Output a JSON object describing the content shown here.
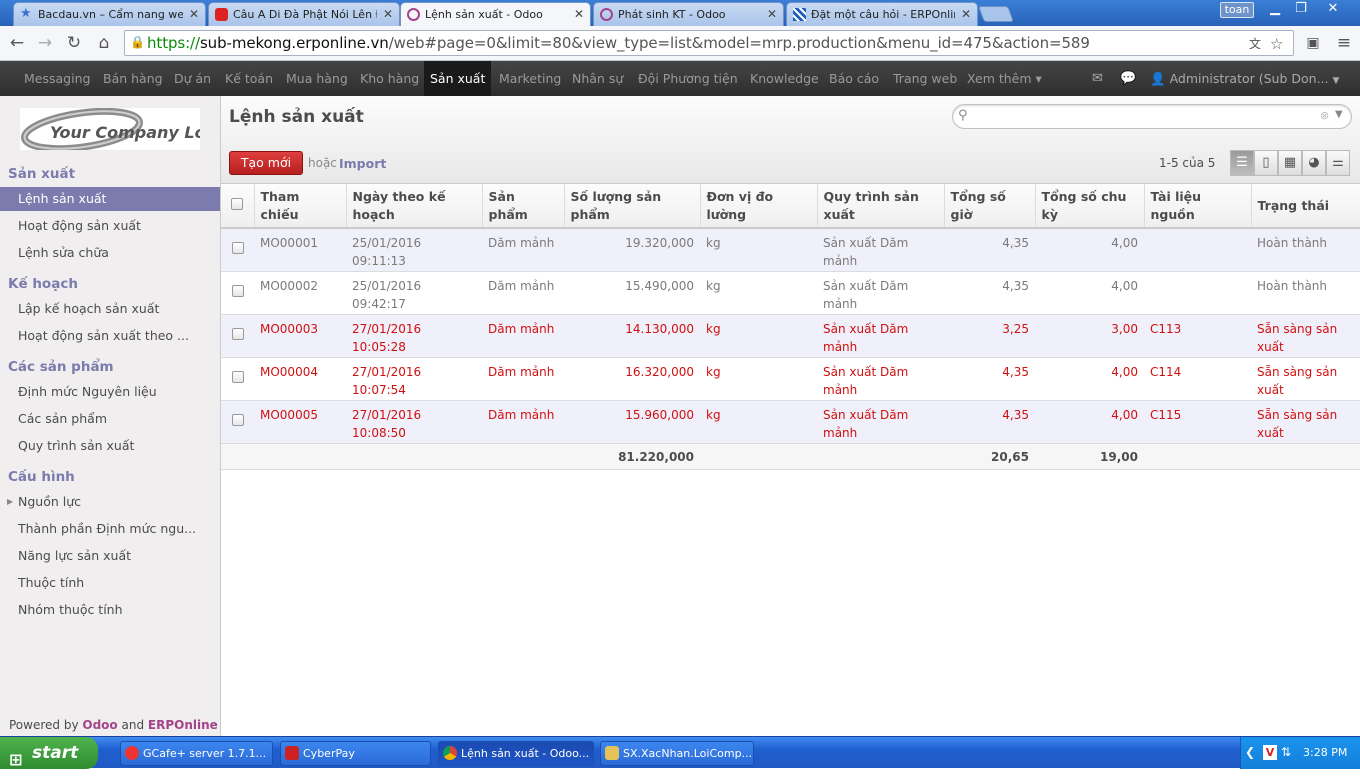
{
  "browser": {
    "tabs": [
      {
        "label": "Bacdau.vn – Cẩm nang web ..."
      },
      {
        "label": "Câu A Di Đà Phật Nói Lên Điề..."
      },
      {
        "label": "Lệnh sản xuất - Odoo"
      },
      {
        "label": "Phát sinh KT - Odoo"
      },
      {
        "label": "Đặt một câu hỏi - ERPOnline"
      }
    ],
    "user_chip": "toan",
    "url_https": "https://",
    "url_host": "sub-mekong.erponline.vn",
    "url_rest": "/web#page=0&limit=80&view_type=list&model=mrp.production&menu_id=475&action=589"
  },
  "topmenu": {
    "items": [
      "Messaging",
      "Bán hàng",
      "Dự án",
      "Kế toán",
      "Mua hàng",
      "Kho hàng",
      "Sản xuất",
      "Marketing",
      "Nhân sự",
      "Đội Phương tiện",
      "Knowledge",
      "Báo cáo",
      "Trang web",
      "Xem thêm ▾"
    ],
    "admin": "Administrator (Sub Don..."
  },
  "sidebar": {
    "logo_text": "Your Company Logo",
    "sections": [
      {
        "title": "Sản xuất",
        "items": [
          "Lệnh sản xuất",
          "Hoạt động sản xuất",
          "Lệnh sửa chữa"
        ]
      },
      {
        "title": "Kế hoạch",
        "items": [
          "Lập kế hoạch sản xuất",
          "Hoạt động sản xuất theo ..."
        ]
      },
      {
        "title": "Các sản phẩm",
        "items": [
          "Định mức Nguyên liệu",
          "Các sản phẩm",
          "Quy trình sản xuất"
        ]
      },
      {
        "title": "Cấu hình",
        "items": [
          "Nguồn lực",
          "Thành phần Định mức ngu...",
          "Năng lực sản xuất",
          "Thuộc tính",
          "Nhóm thuộc tính"
        ]
      }
    ],
    "powered_prefix": "Powered by",
    "powered_odoo": "Odoo",
    "powered_and": "and",
    "powered_erp": "ERPOnline"
  },
  "main": {
    "title": "Lệnh sản xuất",
    "search_value": "",
    "create_label": "Tạo mới",
    "or_label": "hoặc",
    "import_label": "Import",
    "pager": "1-5 của 5"
  },
  "table": {
    "headers": [
      "Tham chiếu",
      "Ngày theo kế hoạch",
      "Sản phẩm",
      "Số lượng sản phẩm",
      "Đơn vị đo lường",
      "Quy trình sản xuất",
      "Tổng số giờ",
      "Tổng số chu kỳ",
      "Tài liệu nguồn",
      "Trạng thái"
    ],
    "rows": [
      {
        "ref": "MO00001",
        "date": "25/01/2016 09:11:13",
        "product": "Dăm mảnh",
        "qty": "19.320,000",
        "uom": "kg",
        "routing": "Sản xuất Dăm mảnh",
        "hours": "4,35",
        "cycles": "4,00",
        "source": "",
        "state": "Hoàn thành"
      },
      {
        "ref": "MO00002",
        "date": "25/01/2016 09:42:17",
        "product": "Dăm mảnh",
        "qty": "15.490,000",
        "uom": "kg",
        "routing": "Sản xuất Dăm mảnh",
        "hours": "4,35",
        "cycles": "4,00",
        "source": "",
        "state": "Hoàn thành"
      },
      {
        "ref": "MO00003",
        "date": "27/01/2016 10:05:28",
        "product": "Dăm mảnh",
        "qty": "14.130,000",
        "uom": "kg",
        "routing": "Sản xuất Dăm mảnh",
        "hours": "3,25",
        "cycles": "3,00",
        "source": "C113",
        "state": "Sẵn sàng sản xuất"
      },
      {
        "ref": "MO00004",
        "date": "27/01/2016 10:07:54",
        "product": "Dăm mảnh",
        "qty": "16.320,000",
        "uom": "kg",
        "routing": "Sản xuất Dăm mảnh",
        "hours": "4,35",
        "cycles": "4,00",
        "source": "C114",
        "state": "Sẵn sàng sản xuất"
      },
      {
        "ref": "MO00005",
        "date": "27/01/2016 10:08:50",
        "product": "Dăm mảnh",
        "qty": "15.960,000",
        "uom": "kg",
        "routing": "Sản xuất Dăm mảnh",
        "hours": "4,35",
        "cycles": "4,00",
        "source": "C115",
        "state": "Sẵn sàng sản xuất"
      }
    ],
    "totals": {
      "qty": "81.220,000",
      "hours": "20,65",
      "cycles": "19,00"
    }
  },
  "taskbar": {
    "start": "start",
    "tasks": [
      "GCafe+ server 1.7.1...",
      "CyberPay",
      "Lệnh sản xuất - Odoo...",
      "SX.XacNhan.LoiComp..."
    ],
    "clock": "3:28 PM"
  },
  "colors": {
    "accent": "#7c7bad",
    "create_button": "#c52a2a",
    "ready_state": "#d01010",
    "odoo_brand": "#a24689"
  }
}
